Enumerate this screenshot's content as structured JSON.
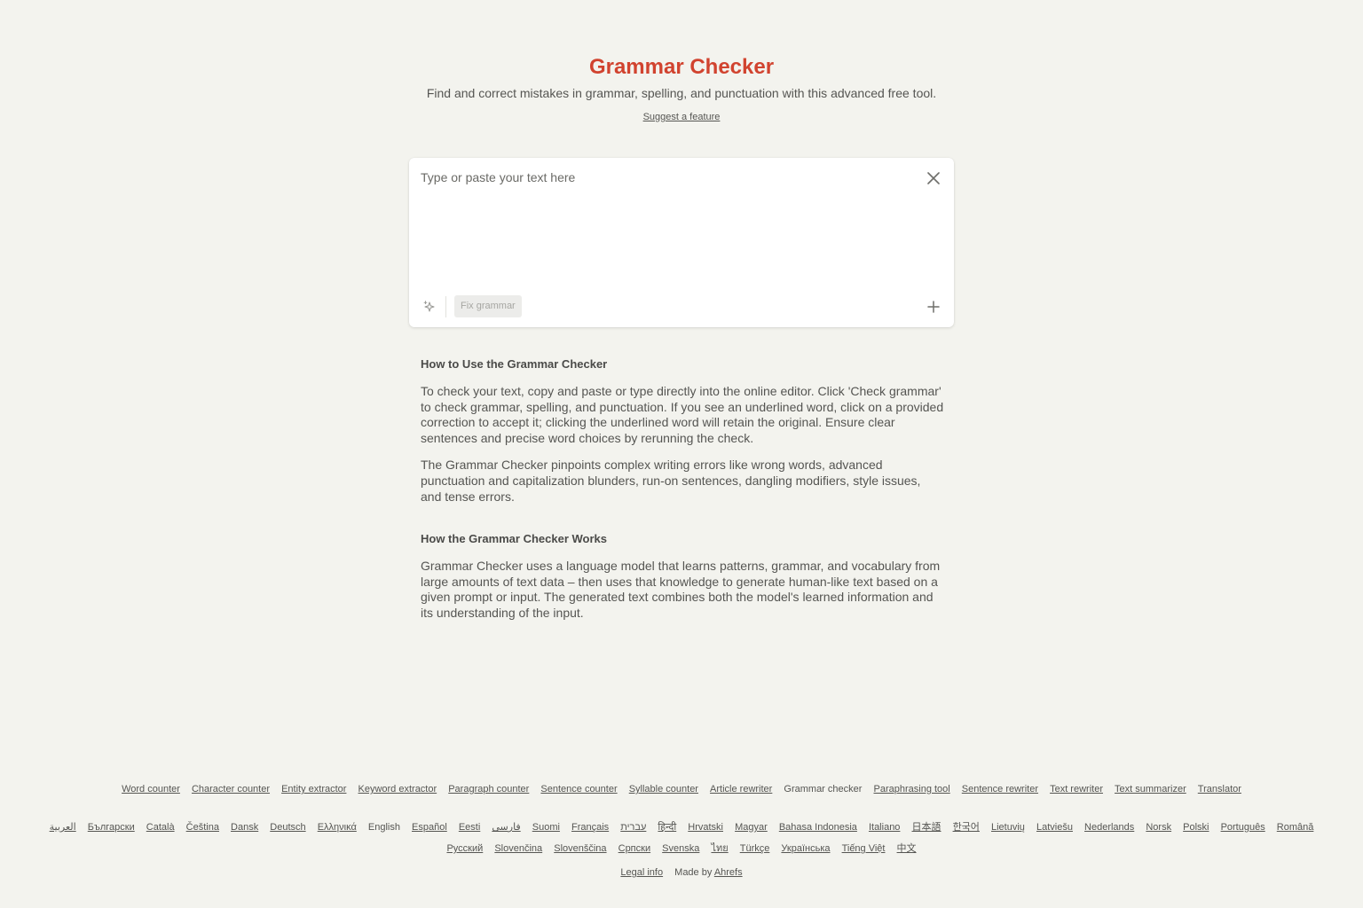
{
  "header": {
    "title": "Grammar Checker",
    "subtitle": "Find and correct mistakes in grammar, spelling, and punctuation with this advanced free tool.",
    "suggest_label": "Suggest a feature"
  },
  "editor": {
    "placeholder": "Type or paste your text here",
    "value": "",
    "fix_button_label": "Fix grammar",
    "close_icon": "close-icon",
    "sparkle_icon": "sparkle-icon",
    "plus_icon": "plus-icon"
  },
  "content": {
    "sections": [
      {
        "heading": "How to Use the Grammar Checker",
        "paragraphs": [
          "To check your text, copy and paste or type directly into the online editor. Click 'Check grammar' to check grammar, spelling, and punctuation. If you see an underlined word, click on a provided correction to accept it; clicking the underlined word will retain the original. Ensure clear sentences and precise word choices by rerunning the check.",
          "The Grammar Checker pinpoints complex writing errors like wrong words, advanced punctuation and capitalization blunders, run-on sentences, dangling modifiers, style issues, and tense errors."
        ]
      },
      {
        "heading": "How the Grammar Checker Works",
        "paragraphs": [
          "Grammar Checker uses a language model that learns patterns, grammar, and vocabulary from large amounts of text data – then uses that knowledge to generate human-like text based on a given prompt or input. The generated text combines both the model's learned information and its understanding of the input."
        ]
      }
    ]
  },
  "footer": {
    "tools": [
      {
        "label": "Word counter",
        "current": false
      },
      {
        "label": "Character counter",
        "current": false
      },
      {
        "label": "Entity extractor",
        "current": false
      },
      {
        "label": "Keyword extractor",
        "current": false
      },
      {
        "label": "Paragraph counter",
        "current": false
      },
      {
        "label": "Sentence counter",
        "current": false
      },
      {
        "label": "Syllable counter",
        "current": false
      },
      {
        "label": "Article rewriter",
        "current": false
      },
      {
        "label": "Grammar checker",
        "current": true
      },
      {
        "label": "Paraphrasing tool",
        "current": false
      },
      {
        "label": "Sentence rewriter",
        "current": false
      },
      {
        "label": "Text rewriter",
        "current": false
      },
      {
        "label": "Text summarizer",
        "current": false
      },
      {
        "label": "Translator",
        "current": false
      }
    ],
    "languages": [
      {
        "label": "العربية",
        "current": false
      },
      {
        "label": "Български",
        "current": false
      },
      {
        "label": "Català",
        "current": false
      },
      {
        "label": "Čeština",
        "current": false
      },
      {
        "label": "Dansk",
        "current": false
      },
      {
        "label": "Deutsch",
        "current": false
      },
      {
        "label": "Ελληνικά",
        "current": false
      },
      {
        "label": "English",
        "current": true
      },
      {
        "label": "Español",
        "current": false
      },
      {
        "label": "Eesti",
        "current": false
      },
      {
        "label": "فارسی",
        "current": false
      },
      {
        "label": "Suomi",
        "current": false
      },
      {
        "label": "Français",
        "current": false
      },
      {
        "label": "עברית",
        "current": false
      },
      {
        "label": "हिन्दी",
        "current": false
      },
      {
        "label": "Hrvatski",
        "current": false
      },
      {
        "label": "Magyar",
        "current": false
      },
      {
        "label": "Bahasa Indonesia",
        "current": false
      },
      {
        "label": "Italiano",
        "current": false
      },
      {
        "label": "日本語",
        "current": false
      },
      {
        "label": "한국어",
        "current": false
      },
      {
        "label": "Lietuvių",
        "current": false
      },
      {
        "label": "Latviešu",
        "current": false
      },
      {
        "label": "Nederlands",
        "current": false
      },
      {
        "label": "Norsk",
        "current": false
      },
      {
        "label": "Polski",
        "current": false
      },
      {
        "label": "Português",
        "current": false
      },
      {
        "label": "Română",
        "current": false
      },
      {
        "label": "Русский",
        "current": false
      },
      {
        "label": "Slovenčina",
        "current": false
      },
      {
        "label": "Slovenščina",
        "current": false
      },
      {
        "label": "Српски",
        "current": false
      },
      {
        "label": "Svenska",
        "current": false
      },
      {
        "label": "ไทย",
        "current": false
      },
      {
        "label": "Türkçe",
        "current": false
      },
      {
        "label": "Українська",
        "current": false
      },
      {
        "label": "Tiếng Việt",
        "current": false
      },
      {
        "label": "中文",
        "current": false
      }
    ],
    "legal_label": "Legal info",
    "made_by_prefix": "Made by",
    "made_by_link": "Ahrefs"
  },
  "colors": {
    "background": "#f3f3ee",
    "accent": "#d1432f",
    "text": "#4a4a48"
  }
}
